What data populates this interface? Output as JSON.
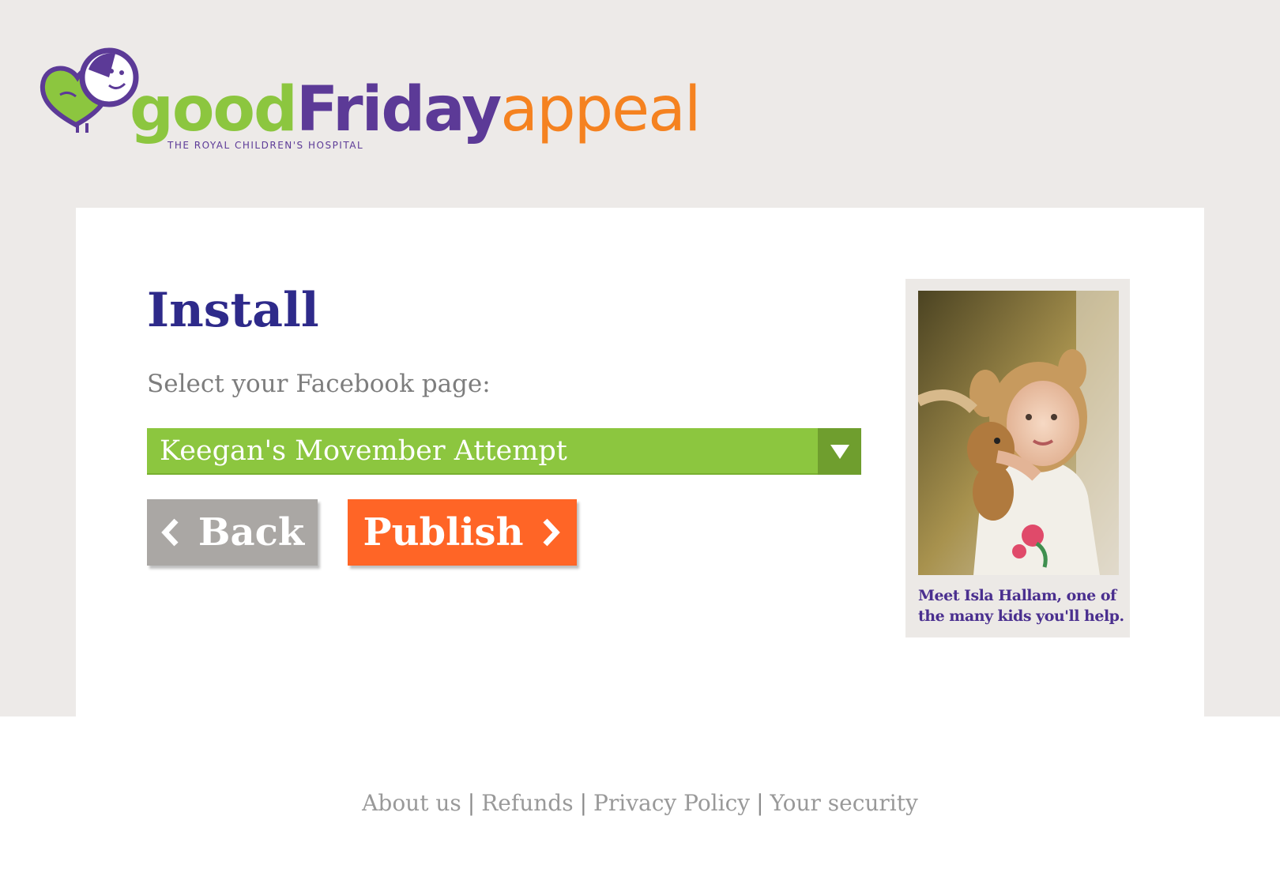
{
  "brand": {
    "word_good": "good",
    "word_friday": "Friday",
    "word_appeal": "appeal",
    "subtitle": "THE ROYAL CHILDREN'S HOSPITAL",
    "colors": {
      "green": "#8cc63f",
      "purple": "#5c3a97",
      "orange": "#f58220"
    }
  },
  "install": {
    "title": "Install",
    "select_label": "Select your Facebook page:",
    "selected_page": "Keegan's Movember Attempt",
    "back_label": "Back",
    "publish_label": "Publish"
  },
  "sidebar": {
    "caption": "Meet Isla Hallam, one of the many kids you'll help."
  },
  "footer": {
    "links": [
      "About us",
      "Refunds",
      "Privacy Policy",
      "Your security"
    ],
    "separator": "|"
  },
  "colors": {
    "background": "#edeae8",
    "title": "#2e2a8a",
    "select": "#8cc63f",
    "back_button": "#aaa7a4",
    "publish_button": "#ff6526"
  }
}
